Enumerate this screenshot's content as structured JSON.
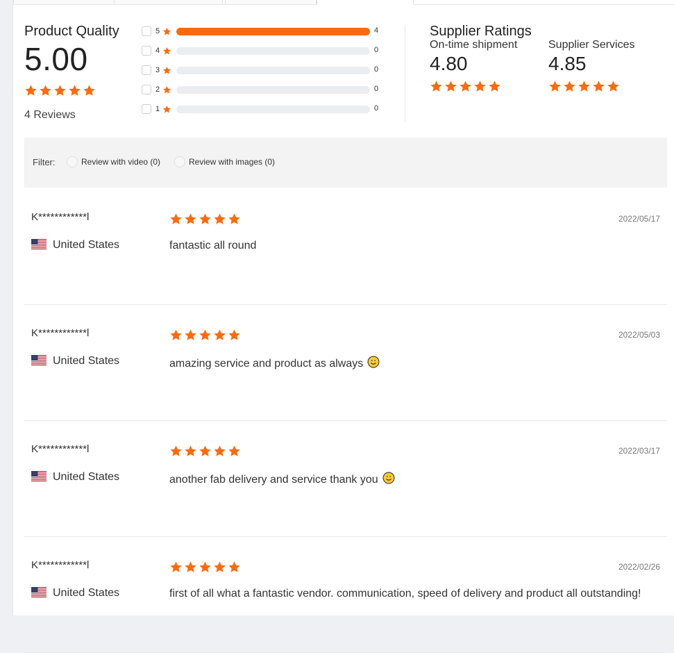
{
  "colors": {
    "accent": "#ff6a0c",
    "track": "#ebedf0",
    "filter_bg": "#f3f3f3"
  },
  "product_quality": {
    "title": "Product Quality",
    "score": "5.00",
    "rating_stars": 5,
    "reviews_label": "4 Reviews",
    "distribution": [
      {
        "stars": "5",
        "count": "4",
        "fraction": 1.0
      },
      {
        "stars": "4",
        "count": "0",
        "fraction": 0.0
      },
      {
        "stars": "3",
        "count": "0",
        "fraction": 0.0
      },
      {
        "stars": "2",
        "count": "0",
        "fraction": 0.0
      },
      {
        "stars": "1",
        "count": "0",
        "fraction": 0.0
      }
    ]
  },
  "supplier_ratings": {
    "title": "Supplier Ratings",
    "ontime": {
      "label": "On-time shipment",
      "score": "4.80",
      "rating_stars": 5
    },
    "services": {
      "label": "Supplier Services",
      "score": "4.85",
      "rating_stars": 5
    }
  },
  "filter": {
    "label": "Filter:",
    "video_option": "Review with video (0)",
    "images_option": "Review with images (0)"
  },
  "reviews": [
    {
      "reviewer": "K************l",
      "country": "United States",
      "flag_icon": "us-flag-icon",
      "rating_stars": 5,
      "text": "fantastic all round",
      "emoji": false,
      "date": "2022/05/17"
    },
    {
      "reviewer": "K************l",
      "country": "United States",
      "flag_icon": "us-flag-icon",
      "rating_stars": 5,
      "text": "amazing service and product as always",
      "emoji": true,
      "date": "2022/05/03"
    },
    {
      "reviewer": "K************l",
      "country": "United States",
      "flag_icon": "us-flag-icon",
      "rating_stars": 5,
      "text": "another fab delivery and service thank you",
      "emoji": true,
      "date": "2022/03/17"
    },
    {
      "reviewer": "K************l",
      "country": "United States",
      "flag_icon": "us-flag-icon",
      "rating_stars": 5,
      "text": "first of all what a fantastic vendor. communication, speed of delivery and product all outstanding!",
      "emoji": false,
      "date": "2022/02/26"
    }
  ]
}
